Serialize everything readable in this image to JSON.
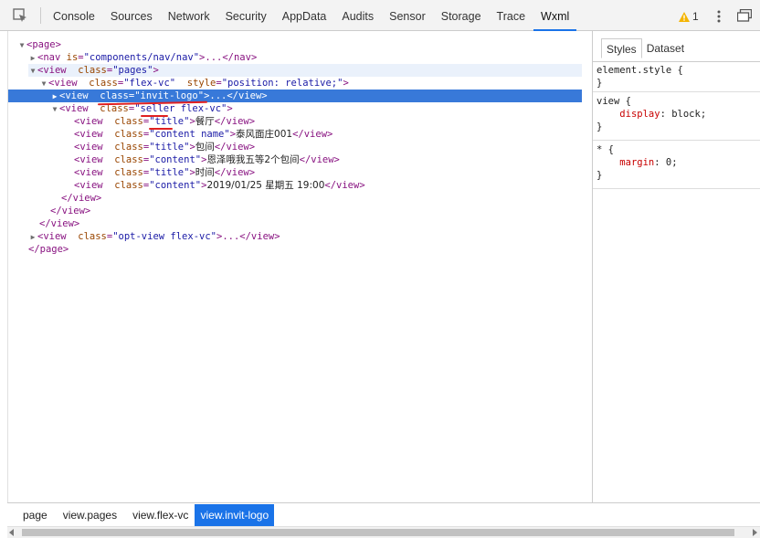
{
  "toolbar": {
    "tabs": [
      "Console",
      "Sources",
      "Network",
      "Security",
      "AppData",
      "Audits",
      "Sensor",
      "Storage",
      "Trace",
      "Wxml"
    ],
    "active_tab": "Wxml",
    "warning_count": "1",
    "colors": {
      "accent": "#1a73e8",
      "warning": "#f4b400"
    }
  },
  "tree": {
    "r1": {
      "tag_open": "<page>"
    },
    "r2": {
      "tag": "<nav",
      "attr": "is",
      "val": "\"components/nav/nav\"",
      "tail": ">...</nav>"
    },
    "r3": {
      "tag": "<view",
      "attr": "class",
      "val": "\"pages\"",
      "tail": ">"
    },
    "r4": {
      "tag": "<view",
      "attr": "class",
      "val": "\"flex-vc\"",
      "attr2": "style",
      "val2": "\"position: relative;\"",
      "tail": ">"
    },
    "r5": {
      "tag": "<view",
      "attr": "class",
      "val": "\"invit-logo\"",
      "tail": ">...</view>"
    },
    "r6": {
      "tag": "<view",
      "attr": "class",
      "val": "\"seller flex-vc\"",
      "tail": ">"
    },
    "r7": {
      "tag": "<view",
      "attr": "class",
      "val": "\"title\"",
      "gt": ">",
      "text": "餐厅",
      "close": "</view>"
    },
    "r8": {
      "tag": "<view",
      "attr": "class",
      "val": "\"content name\"",
      "gt": ">",
      "text": "泰风面庄001",
      "close": "</view>"
    },
    "r9": {
      "tag": "<view",
      "attr": "class",
      "val": "\"title\"",
      "gt": ">",
      "text": "包间",
      "close": "</view>"
    },
    "r10": {
      "tag": "<view",
      "attr": "class",
      "val": "\"content\"",
      "gt": ">",
      "text": "恩泽哦我五等2个包间",
      "close": "</view>"
    },
    "r11": {
      "tag": "<view",
      "attr": "class",
      "val": "\"title\"",
      "gt": ">",
      "text": "时间",
      "close": "</view>"
    },
    "r12": {
      "tag": "<view",
      "attr": "class",
      "val": "\"content\"",
      "gt": ">",
      "text": "2019/01/25 星期五 19:00",
      "close": "</view>"
    },
    "r13": {
      "tag_open": "</view>"
    },
    "r14": {
      "tag_open": "</view>"
    },
    "r15": {
      "tag_open": "</view>"
    },
    "r16": {
      "tag": "<view",
      "attr": "class",
      "val": "\"opt-view flex-vc\"",
      "tail": ">...</view>"
    },
    "r17": {
      "tag_open": "</page>"
    }
  },
  "styles": {
    "tabs": [
      "Styles",
      "Dataset"
    ],
    "element_style": {
      "selector": "element.style {",
      "close": "}"
    },
    "view_rule": {
      "selector": "view {",
      "prop": "display",
      "value": "block;",
      "close": "}"
    },
    "star_rule": {
      "selector": "* {",
      "prop": "margin",
      "value": "0;",
      "close": "}"
    }
  },
  "breadcrumb": [
    "page",
    "view.pages",
    "view.flex-vc",
    "view.invit-logo"
  ]
}
